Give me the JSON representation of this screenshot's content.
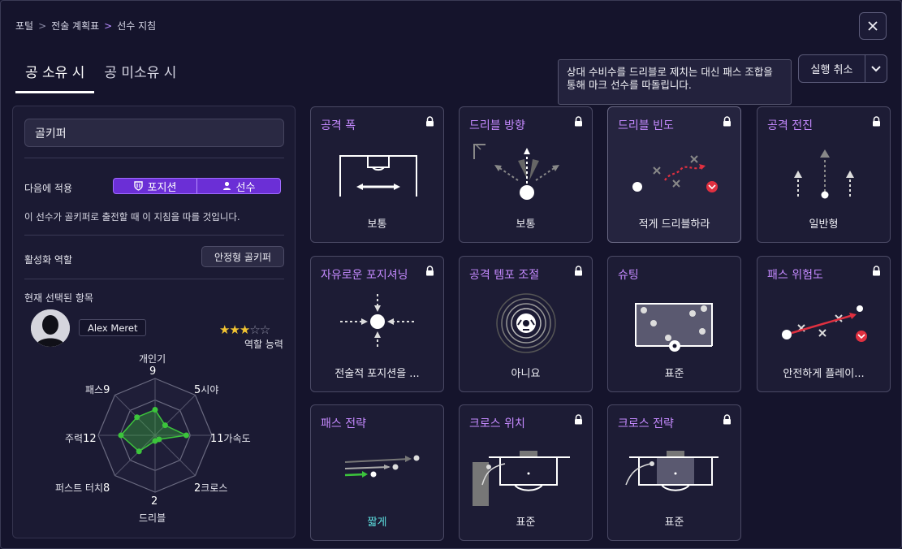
{
  "breadcrumb": {
    "items": [
      "포털",
      "전술 계획표",
      "선수 지침"
    ]
  },
  "tabs": [
    {
      "label": "공 소유 시",
      "active": true
    },
    {
      "label": "공 미소유 시",
      "active": false
    }
  ],
  "tooltip": {
    "text": "상대 수비수를 드리블로 제치는 대신 패스 조합을 통해 마크 선수를 따돌립니다."
  },
  "undo": {
    "label": "실행 취소"
  },
  "left": {
    "role": "골키퍼",
    "apply_label": "다음에 적용",
    "toggle": [
      "포지션",
      "선수"
    ],
    "description": "이 선수가 골키퍼로 출전할 때 이 지침을 따를 것입니다.",
    "active_role_label": "활성화 역할",
    "active_role_value": "안정형 골키퍼",
    "current_label": "현재 선택된 항목",
    "player_name": "Alex Meret",
    "rating": 3,
    "rating_max": 6,
    "role_ability_label": "역할 능력",
    "radar": [
      {
        "label": "개인기",
        "value": "9"
      },
      {
        "label": "시야",
        "value": "5"
      },
      {
        "label": "가속도",
        "value": "11"
      },
      {
        "label": "크로스",
        "value": "2"
      },
      {
        "label": "드리블",
        "value": "2"
      },
      {
        "label": "퍼스트 터치",
        "value": "8"
      },
      {
        "label": "주력",
        "value": "12"
      },
      {
        "label": "패스",
        "value": "9"
      }
    ]
  },
  "cards": [
    {
      "title": "공격 폭",
      "value": "보통",
      "locked": true
    },
    {
      "title": "드리블 방향",
      "value": "보통",
      "locked": true
    },
    {
      "title": "드리블 빈도",
      "value": "적게 드리블하라",
      "locked": true
    },
    {
      "title": "공격 전진",
      "value": "일반형",
      "locked": true
    },
    {
      "title": "자유로운 포지셔닝",
      "value": "전술적 포지션을 ...",
      "locked": true
    },
    {
      "title": "공격 템포 조절",
      "value": "아니요",
      "locked": true
    },
    {
      "title": "슈팅",
      "value": "표준",
      "locked": true
    },
    {
      "title": "패스 위험도",
      "value": "안전하게 플레이...",
      "locked": true
    },
    {
      "title": "패스 전략",
      "value": "짧게",
      "locked": false
    },
    {
      "title": "크로스 위치",
      "value": "표준",
      "locked": true
    },
    {
      "title": "크로스 전략",
      "value": "표준",
      "locked": true
    }
  ],
  "colors": {
    "accent": "#c58aff",
    "toggle": "#6b2fd6",
    "radar": "#3cc43c",
    "danger": "#e03040",
    "value_highlight": "#5ee0e0"
  }
}
